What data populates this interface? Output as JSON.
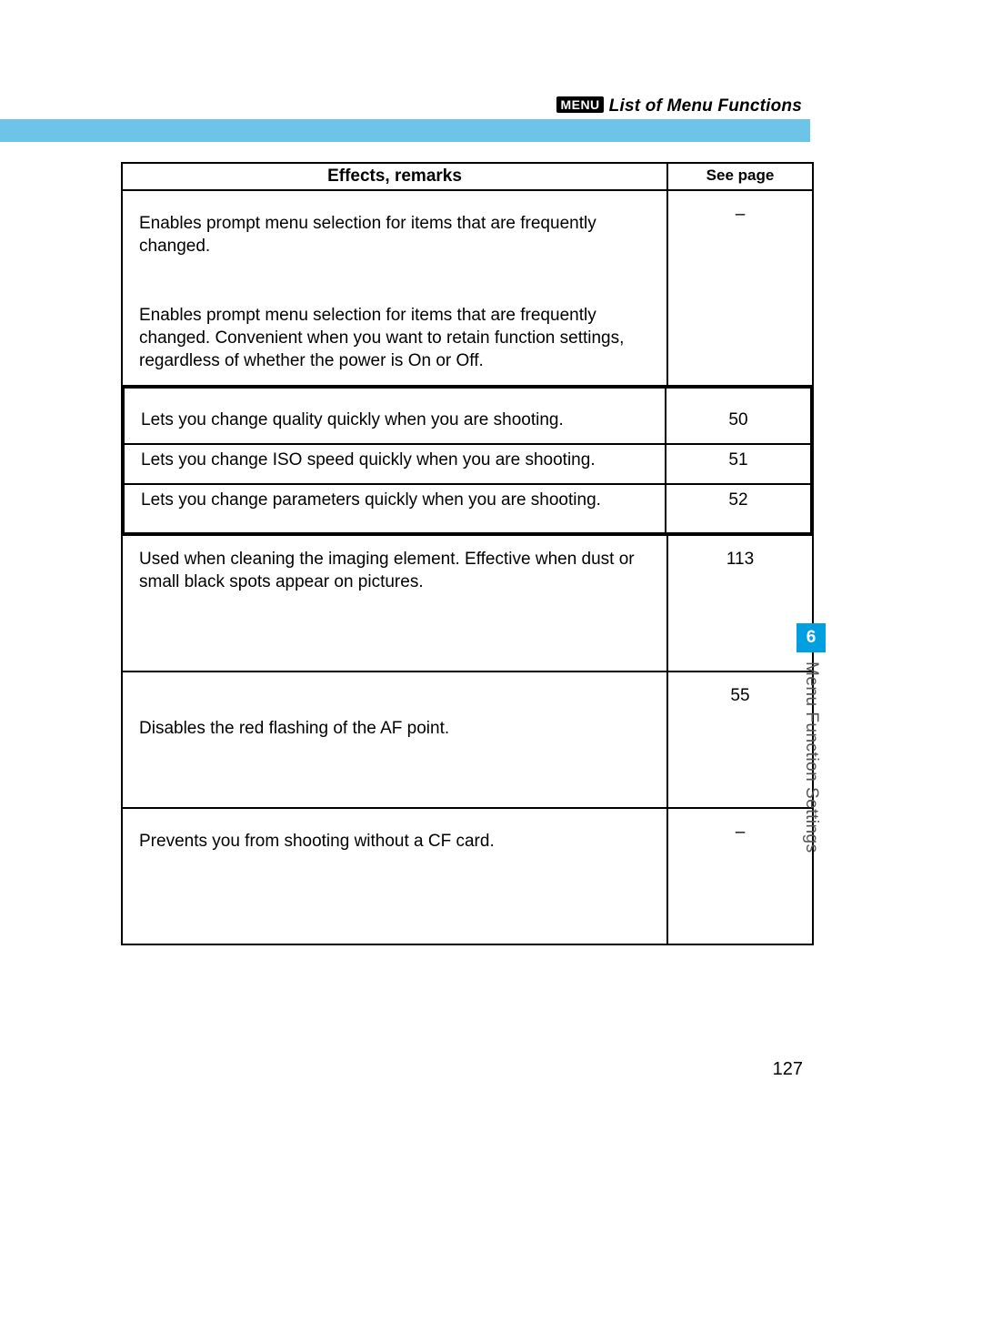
{
  "header": {
    "badge": "MENU",
    "title": "List of Menu Functions"
  },
  "table": {
    "head": {
      "effects": "Effects, remarks",
      "seepage": "See page"
    },
    "group1": {
      "row1": {
        "text": "Enables prompt menu selection for items that are frequently changed.",
        "page": "–"
      },
      "row2": {
        "text": "Enables prompt menu selection for items that are frequently changed. Convenient when you want to retain function settings, regardless of whether the power is On or Off."
      }
    },
    "group2": {
      "r1": {
        "text": "Lets you change quality quickly when you are shooting.",
        "page": "50"
      },
      "r2": {
        "text": "Lets you change ISO speed quickly when you are shooting.",
        "page": "51"
      },
      "r3": {
        "text": "Lets you change parameters quickly when you are shooting.",
        "page": "52"
      }
    },
    "group3": {
      "text": "Used when cleaning the imaging element. Effective when dust or small black spots appear on pictures.",
      "page": "113"
    },
    "group4": {
      "text": "Disables the red flashing of the AF point.",
      "page": "55"
    },
    "group5": {
      "text": "Prevents you from shooting without a CF card.",
      "page": "–"
    }
  },
  "sidetab": {
    "num": "6",
    "label": "Menu Function Settings"
  },
  "pagenum": "127"
}
